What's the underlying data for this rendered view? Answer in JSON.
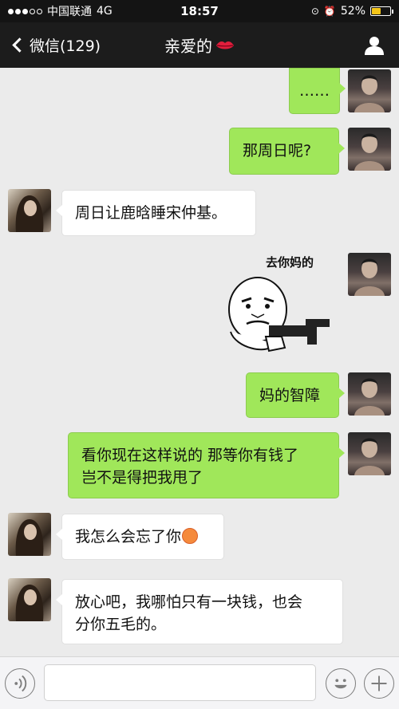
{
  "status_bar": {
    "carrier": "中国联通",
    "network": "4G",
    "time": "18:57",
    "battery_text": "52%",
    "battery_level": 0.52
  },
  "nav": {
    "back_label": "微信(129)",
    "title": "亲爱的",
    "title_icon": "lips-icon",
    "profile_icon": "person-icon"
  },
  "messages": [
    {
      "sender": "me",
      "text": "……"
    },
    {
      "sender": "me",
      "text": "那周日呢?"
    },
    {
      "sender": "her",
      "text": "周日让鹿晗睡宋仲基。"
    },
    {
      "sender": "me",
      "type": "sticker",
      "caption": "去你妈的"
    },
    {
      "sender": "me",
      "text": "妈的智障"
    },
    {
      "sender": "me",
      "text": "看你现在这样说的 那等你有钱了\n岂不是得把我甩了"
    },
    {
      "sender": "her",
      "text": "我怎么会忘了你",
      "emoji": "blushing-face-icon"
    },
    {
      "sender": "her",
      "text": "放心吧，我哪怕只有一块钱，也会\n分你五毛的。"
    }
  ],
  "input_bar": {
    "placeholder": "",
    "voice_icon": "voice-icon",
    "emoji_icon": "smiley-icon",
    "plus_icon": "plus-icon"
  },
  "colors": {
    "sent_bubble": "#a0e75a",
    "received_bubble": "#ffffff",
    "chat_background": "#ebebeb",
    "nav_background": "#1c1c1c"
  }
}
